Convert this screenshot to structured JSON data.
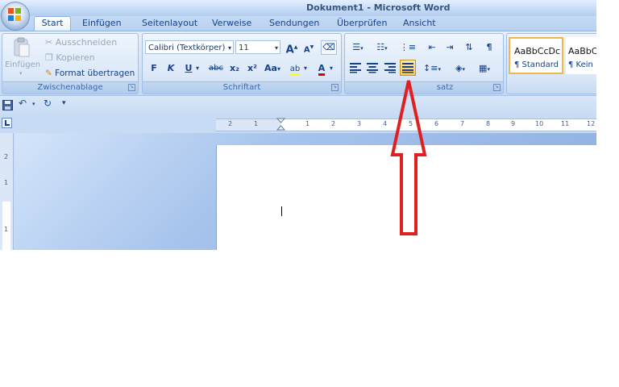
{
  "window": {
    "title": "Dokument1 - Microsoft Word"
  },
  "tabs": [
    "Start",
    "Einfügen",
    "Seitenlayout",
    "Verweise",
    "Sendungen",
    "Überprüfen",
    "Ansicht"
  ],
  "clipboard": {
    "paste_label": "Einfügen",
    "cut_label": "Ausschneiden",
    "copy_label": "Kopieren",
    "format_painter_label": "Format übertragen",
    "group_label": "Zwischenablage"
  },
  "font": {
    "font_name": "Calibri (Textkörper)",
    "font_size": "11",
    "group_label": "Schriftart",
    "bold": "F",
    "italic": "K",
    "underline": "U",
    "strike": "abc",
    "subscript": "x₂",
    "superscript": "x²",
    "change_case": "Aa",
    "grow": "A",
    "shrink": "A",
    "font_color": "A",
    "highlight": "ab"
  },
  "paragraph": {
    "group_label": "Absatz",
    "group_label_visible": "satz",
    "pilcrow": "¶"
  },
  "styles": [
    {
      "preview": "AaBbCcDc",
      "name": "¶ Standard"
    },
    {
      "preview": "AaBbC",
      "name": "¶ Kein L"
    }
  ],
  "ruler_numbers": [
    "2",
    "1",
    "1",
    "2",
    "3",
    "4",
    "5",
    "6",
    "7",
    "8",
    "9",
    "10",
    "11",
    "12"
  ],
  "vruler_numbers": [
    "2",
    "1",
    "1"
  ],
  "colors": {
    "accent": "#15428b",
    "arrow": "#e02020",
    "ribbon_bg": "#dbe8f8",
    "highlight_active": "#ffd25a"
  }
}
